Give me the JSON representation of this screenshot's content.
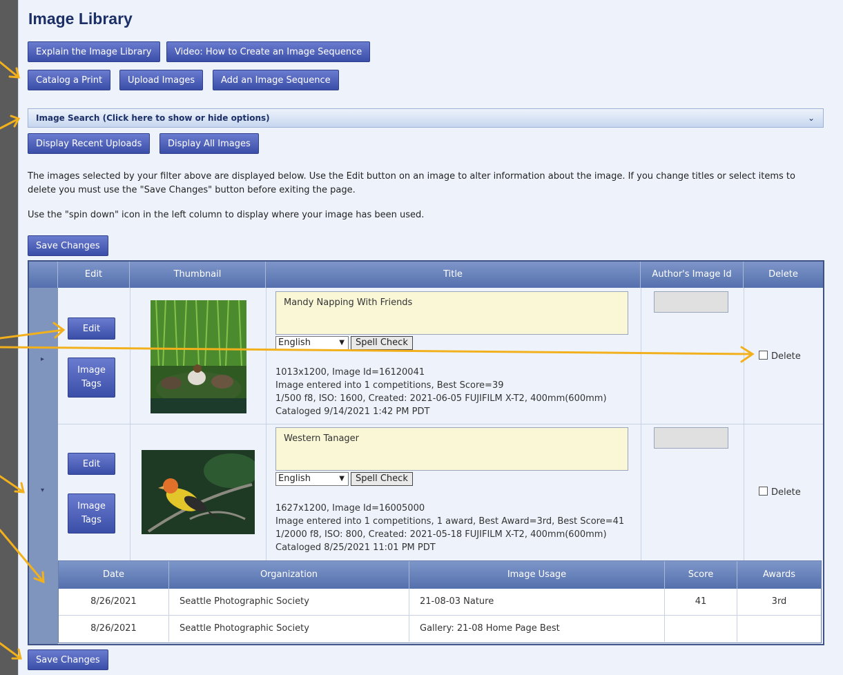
{
  "page": {
    "title": "Image Library",
    "buttons_row1": [
      "Explain the Image Library",
      "Video: How to Create an Image Sequence"
    ],
    "buttons_row2": [
      "Catalog a Print",
      "Upload Images",
      "Add an Image Sequence"
    ],
    "search": {
      "label": "Image Search (Click here to show or hide options)",
      "chevron": "chevron-down-icon"
    },
    "buttons_row3": [
      "Display Recent Uploads",
      "Display All Images"
    ],
    "paragraph1_line1": "The images selected by your filter above are displayed below. Use the Edit button on an image to alter information about the image. If you change titles or select items to",
    "paragraph1_line2": "delete you must use the \"Save Changes\" button before exiting the page.",
    "paragraph2": "Use the \"spin down\" icon in the left column to display where your image has been used.",
    "save_label": "Save Changes"
  },
  "table": {
    "headers": [
      "Edit",
      "Thumbnail",
      "Title",
      "Author's Image Id",
      "Delete"
    ],
    "rows": [
      {
        "expand_icon": "▸",
        "edit_label": "Edit",
        "tags_label_1": "Image",
        "tags_label_2": "Tags",
        "title": "Mandy Napping With Friends",
        "language": "English",
        "spell_label": "Spell Check",
        "info1": "1013x1200, Image Id=16120041",
        "info2": "Image entered into 1 competitions, Best Score=39",
        "info3": "1/500 f8, ISO: 1600, Created: 2021-06-05 FUJIFILM X-T2, 400mm(600mm)",
        "info4": "Cataloged 9/14/2021 1:42 PM PDT",
        "delete_label": "Delete"
      },
      {
        "expand_icon": "▾",
        "edit_label": "Edit",
        "tags_label_1": "Image",
        "tags_label_2": "Tags",
        "title": "Western Tanager",
        "language": "English",
        "spell_label": "Spell Check",
        "info1": "1627x1200, Image Id=16005000",
        "info2": "Image entered into 1 competitions, 1 award, Best Award=3rd, Best Score=41",
        "info3": "1/2000 f8, ISO: 800, Created: 2021-05-18 FUJIFILM X-T2, 400mm(600mm)",
        "info4": "Cataloged 8/25/2021 11:01 PM PDT",
        "delete_label": "Delete"
      }
    ],
    "usage": {
      "headers": [
        "Date",
        "Organization",
        "Image Usage",
        "Score",
        "Awards"
      ],
      "rows": [
        [
          "8/26/2021",
          "Seattle Photographic Society",
          "21-08-03 Nature",
          "41",
          "3rd"
        ],
        [
          "8/26/2021",
          "Seattle Photographic Society",
          "Gallery: 21-08 Home Page Best",
          "",
          ""
        ]
      ]
    }
  },
  "colors": {
    "annotation_arrow": "#f2b01c",
    "button": "#4a5cb5",
    "header": "#6580bd"
  }
}
